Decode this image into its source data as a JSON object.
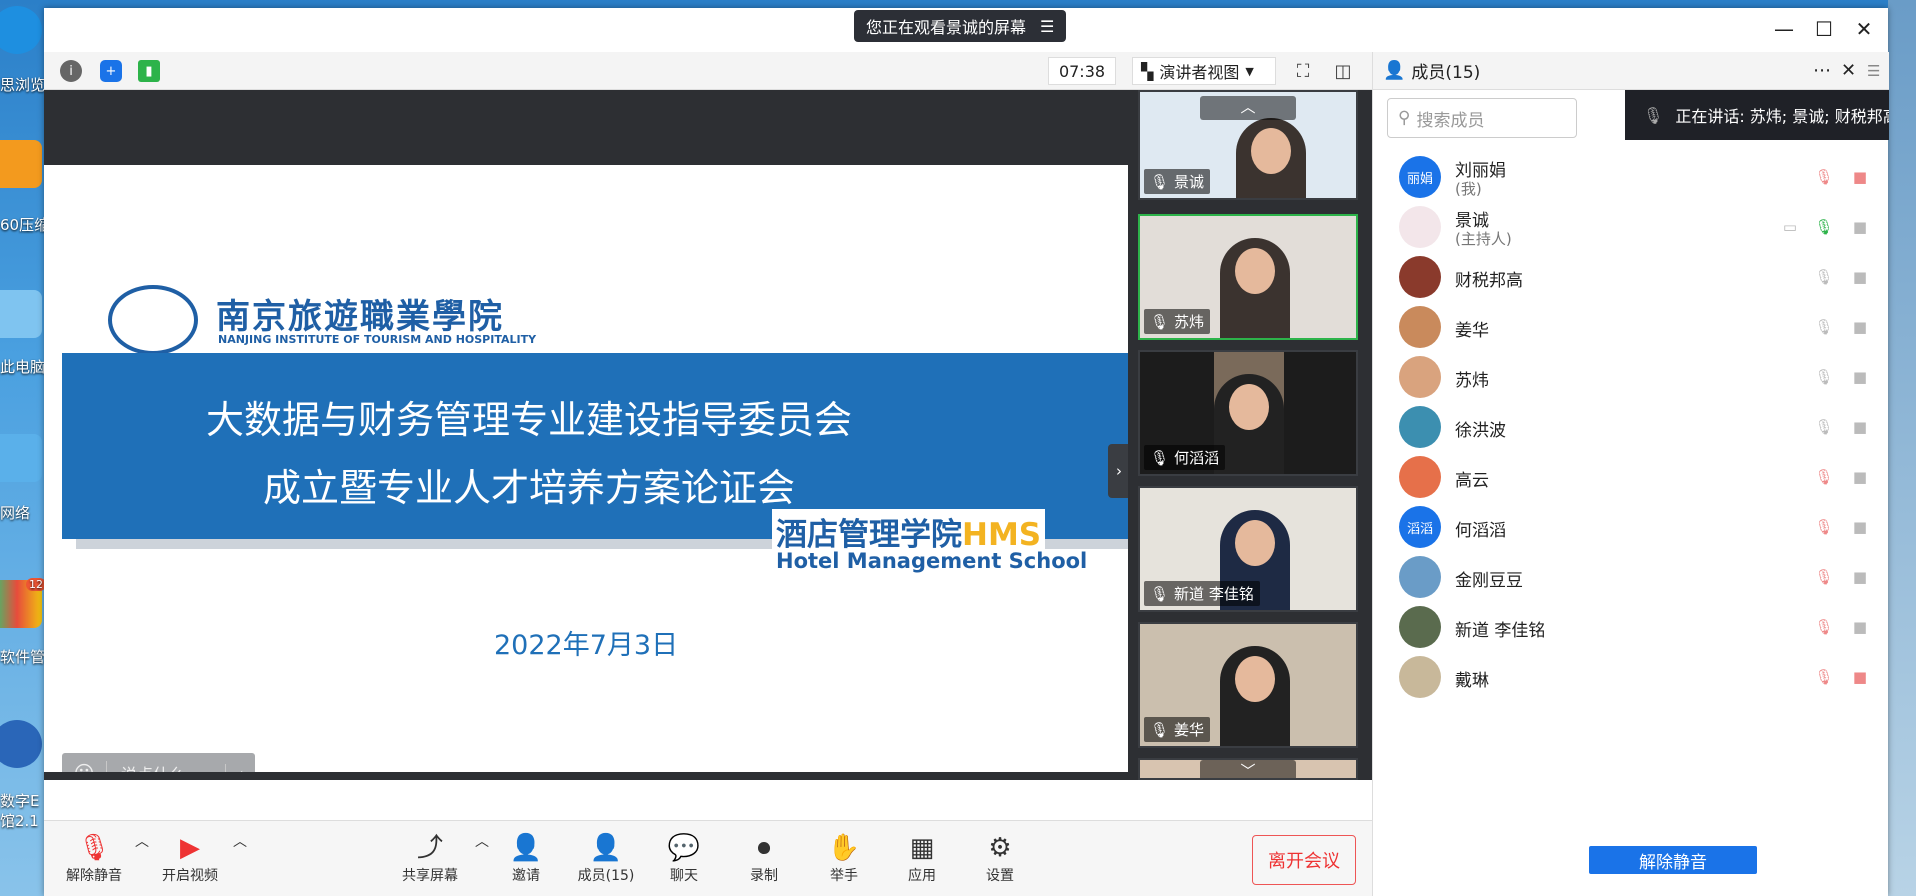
{
  "desktop": {
    "labels": [
      "思浏览",
      "60压缩",
      "此电脑",
      "网络",
      "软件管",
      "数字E",
      "馆2.1"
    ],
    "badge": "12"
  },
  "titlebar": {
    "sharing_banner": "您正在观看景诚的屏幕"
  },
  "toolbar": {
    "timer": "07:38",
    "view_mode": "演讲者视图"
  },
  "slide": {
    "school_cn": "南京旅遊職業學院",
    "school_en": "NANJING INSTITUTE OF TOURISM AND HOSPITALITY",
    "title_line1": "大数据与财务管理专业建设指导委员会",
    "title_line2": "成立暨专业人才培养方案论证会",
    "dept_cn": "酒店管理学院",
    "dept_abbr": "HMS",
    "dept_en": "Hotel Management School",
    "date": "2022年7月3日"
  },
  "chat": {
    "placeholder": "说点什么..."
  },
  "thumbnails": [
    {
      "name": "景诚"
    },
    {
      "name": "苏炜"
    },
    {
      "name": "何滔滔"
    },
    {
      "name": "新道 李佳铭"
    },
    {
      "name": "姜华"
    }
  ],
  "bottombar": {
    "unmute": "解除静音",
    "video": "开启视频",
    "share": "共享屏幕",
    "invite": "邀请",
    "members": "成员(15)",
    "chat": "聊天",
    "record": "录制",
    "raise_hand": "举手",
    "apps": "应用",
    "settings": "设置",
    "leave": "离开会议"
  },
  "panel": {
    "title": "成员(15)",
    "search_placeholder": "搜索成员",
    "speaking": "正在讲话: 苏炜; 景诚; 财税邦高;",
    "members": [
      {
        "name": "刘丽娟",
        "sub": "(我)",
        "avatar_text": "丽娟",
        "avatar_color": "#1a73e8"
      },
      {
        "name": "景诚",
        "sub": "(主持人)",
        "avatar_text": "",
        "avatar_color": "#f3e6ea"
      },
      {
        "name": "财税邦高",
        "sub": "",
        "avatar_text": "",
        "avatar_color": "#8a3a2c"
      },
      {
        "name": "姜华",
        "sub": "",
        "avatar_text": "",
        "avatar_color": "#c98a5c"
      },
      {
        "name": "苏炜",
        "sub": "",
        "avatar_text": "",
        "avatar_color": "#d9a37e"
      },
      {
        "name": "徐洪波",
        "sub": "",
        "avatar_text": "",
        "avatar_color": "#3c8fb0"
      },
      {
        "name": "高云",
        "sub": "",
        "avatar_text": "",
        "avatar_color": "#e6704a"
      },
      {
        "name": "何滔滔",
        "sub": "",
        "avatar_text": "滔滔",
        "avatar_color": "#1a73e8"
      },
      {
        "name": "金刚豆豆",
        "sub": "",
        "avatar_text": "",
        "avatar_color": "#6a9cc7"
      },
      {
        "name": "新道 李佳铭",
        "sub": "",
        "avatar_text": "",
        "avatar_color": "#5a6b4e"
      },
      {
        "name": "戴琳",
        "sub": "",
        "avatar_text": "",
        "avatar_color": "#c8b89a"
      }
    ],
    "unmute_all": "解除静音"
  }
}
